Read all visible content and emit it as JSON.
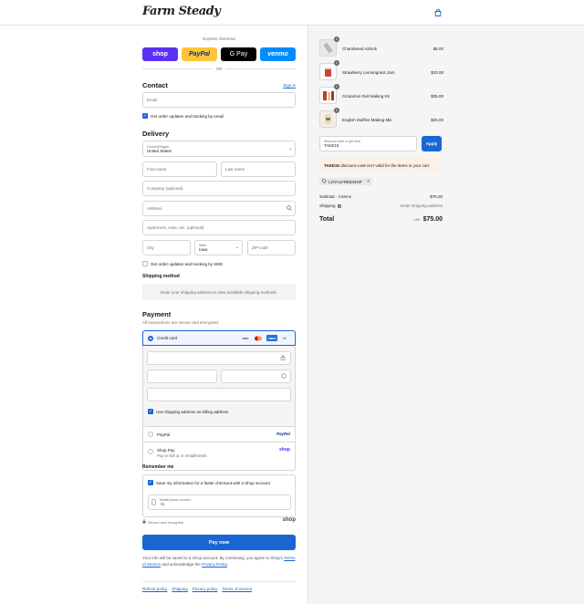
{
  "header": {
    "logo": "Farm Steady",
    "cart_icon": "shopping-bag-icon"
  },
  "express": {
    "label": "Express checkout",
    "buttons": [
      {
        "label": "shop",
        "bg": "#5a31f4",
        "fg": "#ffffff"
      },
      {
        "label": "PayPal",
        "bg": "#ffc439",
        "fg": "#003087"
      },
      {
        "label": "G Pay",
        "bg": "#000000",
        "fg": "#ffffff"
      },
      {
        "label": "venmo",
        "bg": "#008cff",
        "fg": "#ffffff"
      }
    ],
    "or": "OR"
  },
  "contact": {
    "title": "Contact",
    "sign_in": "Sign in",
    "email_placeholder": "Email",
    "email_updates": "Get order updates and tracking by email"
  },
  "delivery": {
    "title": "Delivery",
    "country_label": "Country/Region",
    "country_value": "United States",
    "first_name": "First name",
    "last_name": "Last name",
    "company": "Company (optional)",
    "address": "Address",
    "apartment": "Apartment, suite, etc. (optional)",
    "city": "City",
    "state_label": "State",
    "state_value": "Iowa",
    "zip": "ZIP code",
    "sms_updates": "Get order updates and tracking by SMS"
  },
  "shipping": {
    "title": "Shipping method",
    "notice": "Enter your shipping address to view available shipping methods."
  },
  "payment": {
    "title": "Payment",
    "subtitle": "All transactions are secure and encrypted.",
    "credit_card": "Credit card",
    "card_brands": [
      "VISA",
      "MC",
      "AMEX"
    ],
    "more_brands": "+4",
    "billing_same": "Use shipping address as billing address",
    "paypal": "PayPal",
    "paypal_logo": "PayPal",
    "shop_pay": "Shop Pay",
    "shop_pay_sub": "Pay in full or in installments",
    "shop_pay_logo": "shop"
  },
  "remember": {
    "title": "Remember me",
    "save_info": "Save my information for a faster checkout with a Shop account",
    "phone_label": "Mobile phone number",
    "phone_value": "+1",
    "secure": "Secure and encrypted",
    "shop_logo": "shop"
  },
  "pay_now": "Pay now",
  "legal": {
    "text1": "Your info will be saved to a Shop account. By continuing, you agree to Shop's",
    "tos": "Terms of Service",
    "text2": "and acknowledge the",
    "privacy": "Privacy Policy",
    "end": "."
  },
  "footer_links": [
    "Refund policy",
    "Shipping",
    "Privacy policy",
    "Terms of service"
  ],
  "cart": {
    "items": [
      {
        "qty": "1",
        "name": "Chambered Airlock",
        "price": "$5.00"
      },
      {
        "qty": "1",
        "name": "Strawberry Lemongrass Jam",
        "price": "$10.00"
      },
      {
        "qty": "1",
        "name": "Cinnamon Roll Making Kit",
        "price": "$35.00"
      },
      {
        "qty": "1",
        "name": "English Muffins Making Mix",
        "price": "$25.00"
      }
    ],
    "discount_label": "Discount code or gift card",
    "discount_value": "TAKE15",
    "apply": "Apply",
    "warning_code": "TAKE15",
    "warning_text": "discount code isn't valid for the items in your cart",
    "tag": "LOYALFREESHIP",
    "subtotal_label": "Subtotal · 4 items",
    "subtotal_value": "$75.00",
    "shipping_label": "Shipping",
    "shipping_value": "Enter shipping address",
    "total_label": "Total",
    "currency": "USD",
    "total_value": "$75.00"
  }
}
